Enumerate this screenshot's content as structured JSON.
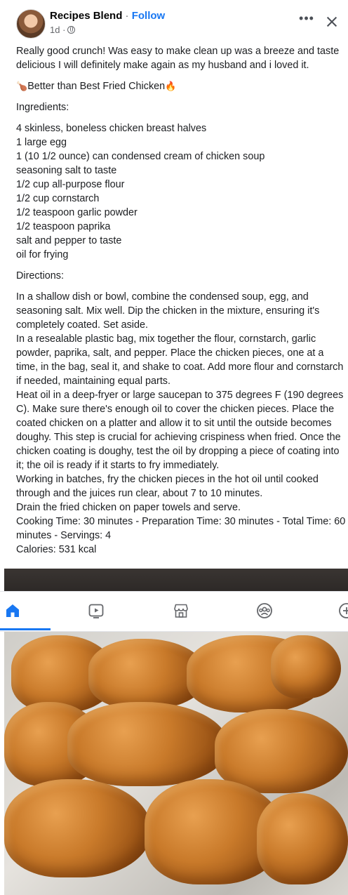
{
  "post": {
    "author": "Recipes Blend",
    "separator": " · ",
    "follow_label": "Follow",
    "time": "1d ·",
    "more_label": "•••",
    "intro": "Really good crunch! Was easy to make clean up was a breeze and taste delicious I will definitely make again as my husband and i loved it.",
    "title": "Better than Best Fried Chicken",
    "ingredients_heading": "Ingredients:",
    "ingredients": [
      "4 skinless, boneless chicken breast halves",
      "1 large egg",
      "1 (10 1/2 ounce) can condensed cream of chicken soup",
      "seasoning salt to taste",
      "1/2 cup all-purpose flour",
      "1/2 cup cornstarch",
      "1/2 teaspoon garlic powder",
      "1/2 teaspoon paprika",
      "salt and pepper to taste",
      "oil for frying"
    ],
    "directions_heading": "Directions:",
    "directions": [
      "In a shallow dish or bowl, combine the condensed soup, egg, and seasoning salt. Mix well. Dip the chicken in the mixture, ensuring it's completely coated. Set aside.",
      "In a resealable plastic bag, mix together the flour, cornstarch, garlic powder, paprika, salt, and pepper. Place the chicken pieces, one at a time, in the bag, seal it, and shake to coat. Add more flour and cornstarch if needed, maintaining equal parts.",
      "Heat oil in a deep-fryer or large saucepan to 375 degrees F (190 degrees C). Make sure there's enough oil to cover the chicken pieces. Place the coated chicken on a platter and allow it to sit until the outside becomes doughy. This step is crucial for achieving crispiness when fried. Once the chicken coating is doughy, test the oil by dropping a piece of coating into it; the oil is ready if it starts to fry immediately.",
      "Working in batches, fry the chicken pieces in the hot oil until cooked through and the juices run clear, about 7 to 10 minutes.",
      "Drain the fried chicken on paper towels and serve."
    ],
    "times": "Cooking Time: 30 minutes - Preparation Time: 30 minutes - Total Time: 60 minutes - Servings: 4",
    "calories": "Calories: 531 kcal"
  },
  "icons": {
    "title_prefix": "drumstick-emoji",
    "title_suffix": "fire-emoji",
    "emoji_prefix_glyph": "🍗",
    "emoji_suffix_glyph": "🔥"
  },
  "nav": {
    "active": "home",
    "accent_color": "#1877f2",
    "items": [
      "home",
      "video",
      "marketplace",
      "groups",
      "create"
    ]
  }
}
